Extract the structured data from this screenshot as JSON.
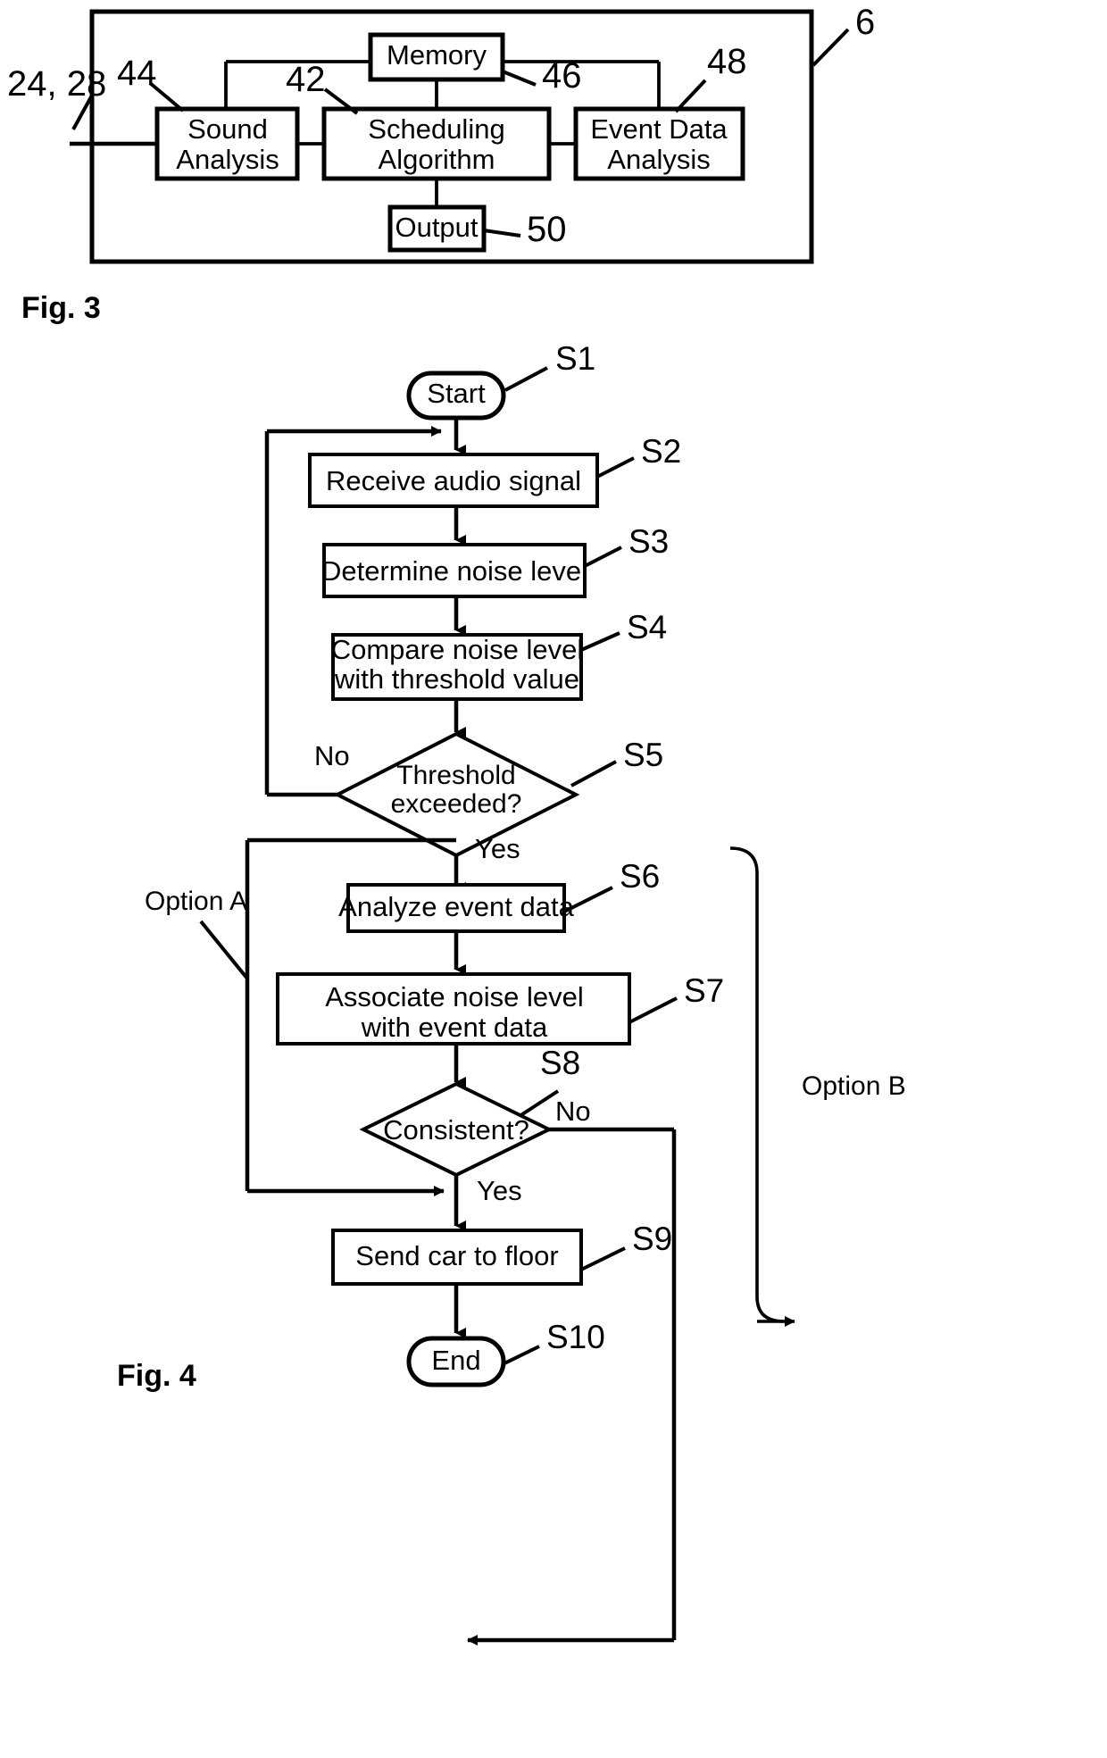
{
  "figures": [
    {
      "id": "fig3",
      "caption": "Fig. 3",
      "outer_ref": "6",
      "input_ref": "24, 28",
      "blocks": [
        {
          "key": "memory",
          "label": "Memory",
          "ref": "46"
        },
        {
          "key": "sound",
          "label_line1": "Sound",
          "label_line2": "Analysis",
          "ref": "44"
        },
        {
          "key": "sched",
          "label_line1": "Scheduling",
          "label_line2": "Algorithm",
          "ref": "42"
        },
        {
          "key": "event",
          "label_line1": "Event Data",
          "label_line2": "Analysis",
          "ref": "48"
        },
        {
          "key": "output",
          "label": "Output",
          "ref": "50"
        }
      ]
    },
    {
      "id": "fig4",
      "caption": "Fig. 4",
      "option_a_label": "Option A",
      "option_b_label": "Option B",
      "yes_label": "Yes",
      "no_label": "No",
      "nodes": [
        {
          "key": "s1",
          "ref": "S1",
          "shape": "terminator",
          "label": "Start"
        },
        {
          "key": "s2",
          "ref": "S2",
          "shape": "process",
          "label": "Receive audio signal"
        },
        {
          "key": "s3",
          "ref": "S3",
          "shape": "process",
          "label": "Determine noise level"
        },
        {
          "key": "s4",
          "ref": "S4",
          "shape": "process",
          "label_line1": "Compare noise level",
          "label_line2": "with threshold value"
        },
        {
          "key": "s5",
          "ref": "S5",
          "shape": "decision",
          "label_line1": "Threshold",
          "label_line2": "exceeded?"
        },
        {
          "key": "s6",
          "ref": "S6",
          "shape": "process",
          "label": "Analyze event data"
        },
        {
          "key": "s7",
          "ref": "S7",
          "shape": "process",
          "label_line1": "Associate noise level",
          "label_line2": "with event data"
        },
        {
          "key": "s8",
          "ref": "S8",
          "shape": "decision",
          "label": "Consistent?"
        },
        {
          "key": "s9",
          "ref": "S9",
          "shape": "process",
          "label": "Send car to floor"
        },
        {
          "key": "s10",
          "ref": "S10",
          "shape": "terminator",
          "label": "End"
        }
      ],
      "branch_labels": {
        "s5_no": "No",
        "s5_yes": "Yes",
        "s8_no": "No",
        "s8_yes": "Yes"
      }
    }
  ]
}
